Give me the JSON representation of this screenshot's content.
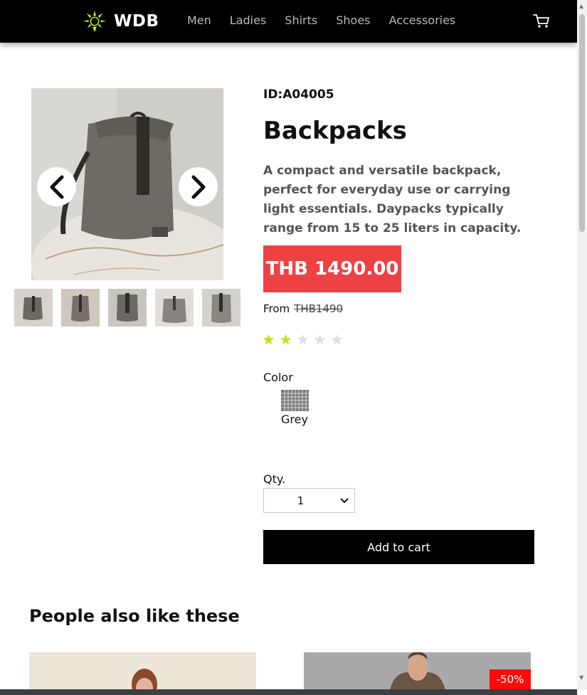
{
  "header": {
    "brand": "WDB",
    "nav": [
      "Men",
      "Ladies",
      "Shirts",
      "Shoes",
      "Accessories"
    ],
    "cart_icon": "cart-icon"
  },
  "gallery": {
    "prev_icon": "chevron-left-icon",
    "next_icon": "chevron-right-icon",
    "thumbnail_count": 5
  },
  "product": {
    "id": "ID:A04005",
    "title": "Backpacks",
    "description": "A compact and versatile backpack, perfect for everyday use or carrying light essentials. Daypacks typically range from 15 to 25 liters in capacity.",
    "price": "THB 1490.00",
    "from_label": "From",
    "old_price": "THB1490",
    "rating": 2,
    "rating_max": 5,
    "color_label": "Color",
    "color_name": "Grey",
    "qty_label": "Qty.",
    "qty_value": "1",
    "add_to_cart": "Add to cart"
  },
  "related": {
    "title": "People also like these",
    "discount_badge": "-50%"
  },
  "colors": {
    "header_bg": "#000000",
    "price_bg": "#ee4144",
    "star_on": "#c8e02a",
    "star_off": "#e0e0e0",
    "badge_bg": "#ff0a0a",
    "logo_accent": "#c6f51c"
  }
}
